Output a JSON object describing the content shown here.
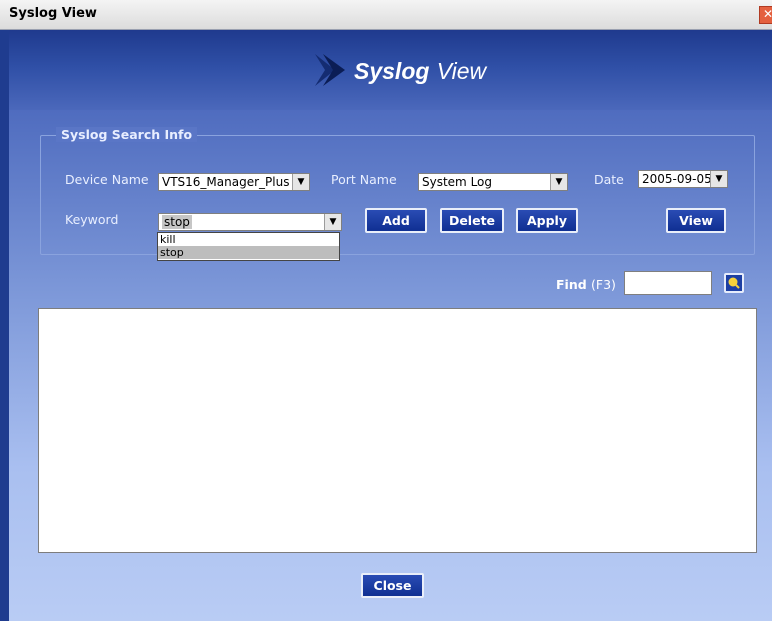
{
  "window": {
    "title": "Syslog View"
  },
  "banner": {
    "title_bold": "Syslog",
    "title_rest": "View"
  },
  "search_info": {
    "legend": "Syslog Search Info",
    "device_name": {
      "label": "Device Name",
      "value": "VTS16_Manager_Plus"
    },
    "port_name": {
      "label": "Port Name",
      "value": "System Log"
    },
    "date": {
      "label": "Date",
      "value": "2005-09-05"
    },
    "keyword": {
      "label": "Keyword",
      "value": "stop",
      "options": [
        "kill",
        "stop"
      ],
      "highlighted": "stop"
    },
    "buttons": {
      "add": "Add",
      "delete": "Delete",
      "apply": "Apply",
      "view": "View"
    }
  },
  "find": {
    "label": "Find",
    "shortcut": "(F3)",
    "value": ""
  },
  "footer": {
    "close": "Close"
  },
  "icons": {
    "window_close": "close-icon",
    "banner": "arrow-icon",
    "find": "search-icon",
    "combo": "chevron-down-icon"
  },
  "colors": {
    "banner": "#2f4fa6",
    "button": "#1b3ca8",
    "background": "#8fa6dc"
  }
}
